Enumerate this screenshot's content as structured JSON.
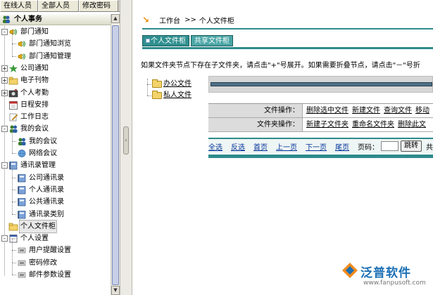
{
  "top_tabs": [
    "在线人员",
    "全部人员",
    "修改密码"
  ],
  "section_title": "个人事务",
  "tree": [
    {
      "label": "部门通知",
      "level": 1,
      "toggle": "-",
      "icon": "megaphone-icon"
    },
    {
      "label": "部门通知浏览",
      "level": 2,
      "toggle": "",
      "icon": "megaphone-icon"
    },
    {
      "label": "部门通知管理",
      "level": 2,
      "toggle": "",
      "icon": "megaphone-icon"
    },
    {
      "label": "公司通知",
      "level": 1,
      "toggle": "+",
      "icon": "star-icon"
    },
    {
      "label": "电子刊物",
      "level": 1,
      "toggle": "+",
      "icon": "folder-icon"
    },
    {
      "label": "个人考勤",
      "level": 1,
      "toggle": "+",
      "icon": "camera-icon"
    },
    {
      "label": "日程安排",
      "level": 1,
      "toggle": "",
      "icon": "calendar-icon"
    },
    {
      "label": "工作日志",
      "level": 1,
      "toggle": "",
      "icon": "pencil-icon"
    },
    {
      "label": "我的会议",
      "level": 1,
      "toggle": "-",
      "icon": "people-icon"
    },
    {
      "label": "我的会议",
      "level": 2,
      "toggle": "",
      "icon": "people-icon"
    },
    {
      "label": "网络会议",
      "level": 2,
      "toggle": "",
      "icon": "network-icon"
    },
    {
      "label": "通讯录管理",
      "level": 1,
      "toggle": "-",
      "icon": "addressbook-icon"
    },
    {
      "label": "公司通讯录",
      "level": 2,
      "toggle": "",
      "icon": "addressbook-icon"
    },
    {
      "label": "个人通讯录",
      "level": 2,
      "toggle": "",
      "icon": "addressbook-icon"
    },
    {
      "label": "公共通讯录",
      "level": 2,
      "toggle": "",
      "icon": "addressbook-icon"
    },
    {
      "label": "通讯录类别",
      "level": 2,
      "toggle": "",
      "icon": "addressbook-icon"
    },
    {
      "label": "个人文件柜",
      "level": 1,
      "toggle": "",
      "icon": "cabinet-icon",
      "selected": true
    },
    {
      "label": "个人设置",
      "level": 1,
      "toggle": "-",
      "icon": "settings-icon"
    },
    {
      "label": "用户提醒设置",
      "level": 2,
      "toggle": "",
      "icon": "bell-icon"
    },
    {
      "label": "密码修改",
      "level": 2,
      "toggle": "",
      "icon": "key-icon"
    },
    {
      "label": "邮件参数设置",
      "level": 2,
      "toggle": "",
      "icon": "mail-icon"
    }
  ],
  "breadcrumb": {
    "home": "工作台",
    "sep": ">>",
    "current": "个人文件柜"
  },
  "tabs": [
    {
      "label": "个人文件柜",
      "active": true
    },
    {
      "label": "共享文件柜",
      "active": false
    }
  ],
  "hint": "如果文件夹节点下存在子文件夹，请点击\"+\"号展开。如果需要折叠节点，请点击\"－\"号折",
  "folders": [
    "办公文件",
    "私人文件"
  ],
  "ops": [
    {
      "label": "文件操作：",
      "links": [
        "删除选中文件",
        "新建文件",
        "查询文件",
        "移动"
      ]
    },
    {
      "label": "文件夹操作：",
      "links": [
        "新建子文件夹",
        "重命名文件夹",
        "删除此文"
      ]
    }
  ],
  "pager": {
    "select_all": "全选",
    "invert": "反选",
    "first": "首页",
    "prev": "上一页",
    "next": "下一页",
    "last": "尾页",
    "page_label": "页码：",
    "go": "跳转",
    "tail": "共"
  },
  "logo": {
    "brand": "泛普软件",
    "url": "www.fanpusoft.com"
  },
  "colors": {
    "teal": "#2e8b8b",
    "brand_blue": "#1b6fb4",
    "logo_orange": "#f08a1e"
  }
}
